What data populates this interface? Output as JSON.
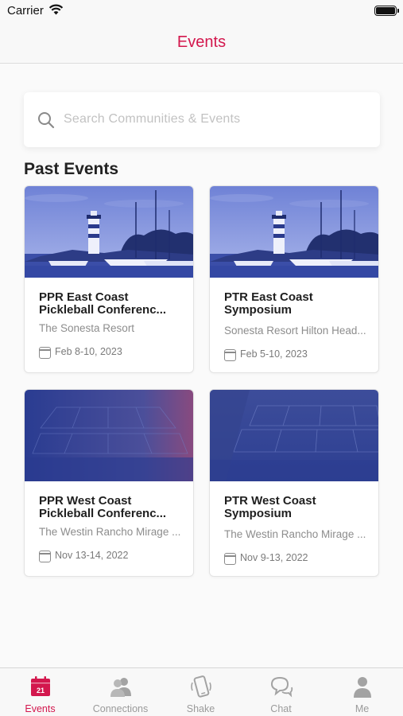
{
  "status_bar": {
    "carrier": "Carrier"
  },
  "nav": {
    "title": "Events"
  },
  "search": {
    "placeholder": "Search Communities & Events"
  },
  "section": {
    "title": "Past Events"
  },
  "events": [
    {
      "title": "PPR East Coast Pickleball Conferenc...",
      "venue": "The Sonesta Resort",
      "date": "Feb 8-10, 2023",
      "image": "harbor-lighthouse"
    },
    {
      "title": "PTR East Coast Symposium",
      "venue": "Sonesta Resort Hilton Head...",
      "date": "Feb 5-10, 2023",
      "image": "harbor-lighthouse"
    },
    {
      "title": "PPR West Coast Pickleball Conferenc...",
      "venue": "The Westin Rancho Mirage ...",
      "date": "Nov 13-14, 2022",
      "image": "courts-aerial"
    },
    {
      "title": "PTR West Coast Symposium",
      "venue": "The Westin Rancho Mirage ...",
      "date": "Nov 9-13, 2022",
      "image": "courts-aerial"
    }
  ],
  "tabs": [
    {
      "label": "Events",
      "icon": "calendar-icon",
      "badge": "21",
      "active": true
    },
    {
      "label": "Connections",
      "icon": "people-icon",
      "active": false
    },
    {
      "label": "Shake",
      "icon": "phone-shake-icon",
      "active": false
    },
    {
      "label": "Chat",
      "icon": "chat-bubbles-icon",
      "active": false
    },
    {
      "label": "Me",
      "icon": "person-icon",
      "active": false
    }
  ],
  "colors": {
    "accent": "#d3174d",
    "inactive": "#9a9a9a",
    "image_tint": "#3a4fa3"
  }
}
